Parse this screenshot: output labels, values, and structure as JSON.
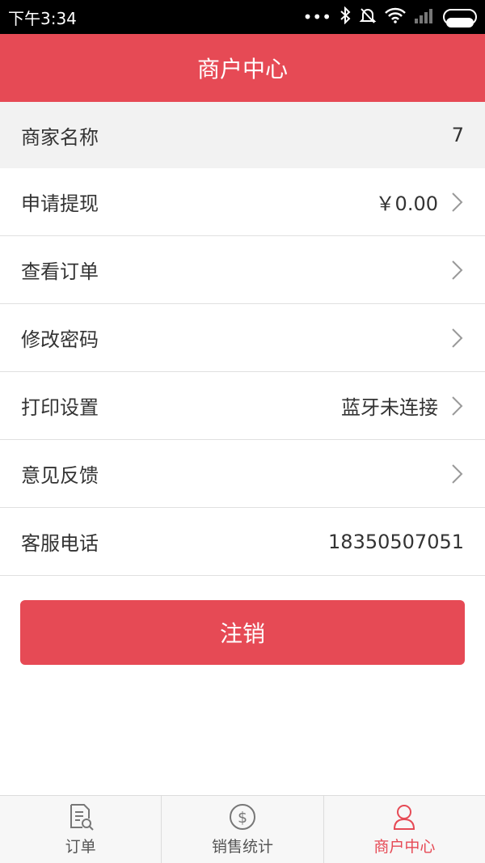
{
  "status": {
    "time": "下午3:34",
    "icons": [
      "more-icon",
      "bluetooth-icon",
      "mute-icon",
      "wifi-icon",
      "signal-icon",
      "battery-icon"
    ]
  },
  "header": {
    "title": "商户中心"
  },
  "merchant": {
    "label": "商家名称",
    "value": "7"
  },
  "menu": [
    {
      "label": "申请提现",
      "value": "￥0.00",
      "chevron": true
    },
    {
      "label": "查看订单",
      "value": "",
      "chevron": true
    },
    {
      "label": "修改密码",
      "value": "",
      "chevron": true
    },
    {
      "label": "打印设置",
      "value": "蓝牙未连接",
      "chevron": true
    },
    {
      "label": "意见反馈",
      "value": "",
      "chevron": true
    },
    {
      "label": "客服电话",
      "value": "18350507051",
      "chevron": false
    }
  ],
  "logout": {
    "label": "注销"
  },
  "tabs": [
    {
      "label": "订单",
      "icon": "order-list-icon",
      "active": false
    },
    {
      "label": "销售统计",
      "icon": "dollar-icon",
      "active": false
    },
    {
      "label": "商户中心",
      "icon": "user-icon",
      "active": true
    }
  ],
  "colors": {
    "accent": "#e64a55",
    "divider": "#e0e0e0",
    "gray_row": "#f2f2f2"
  }
}
